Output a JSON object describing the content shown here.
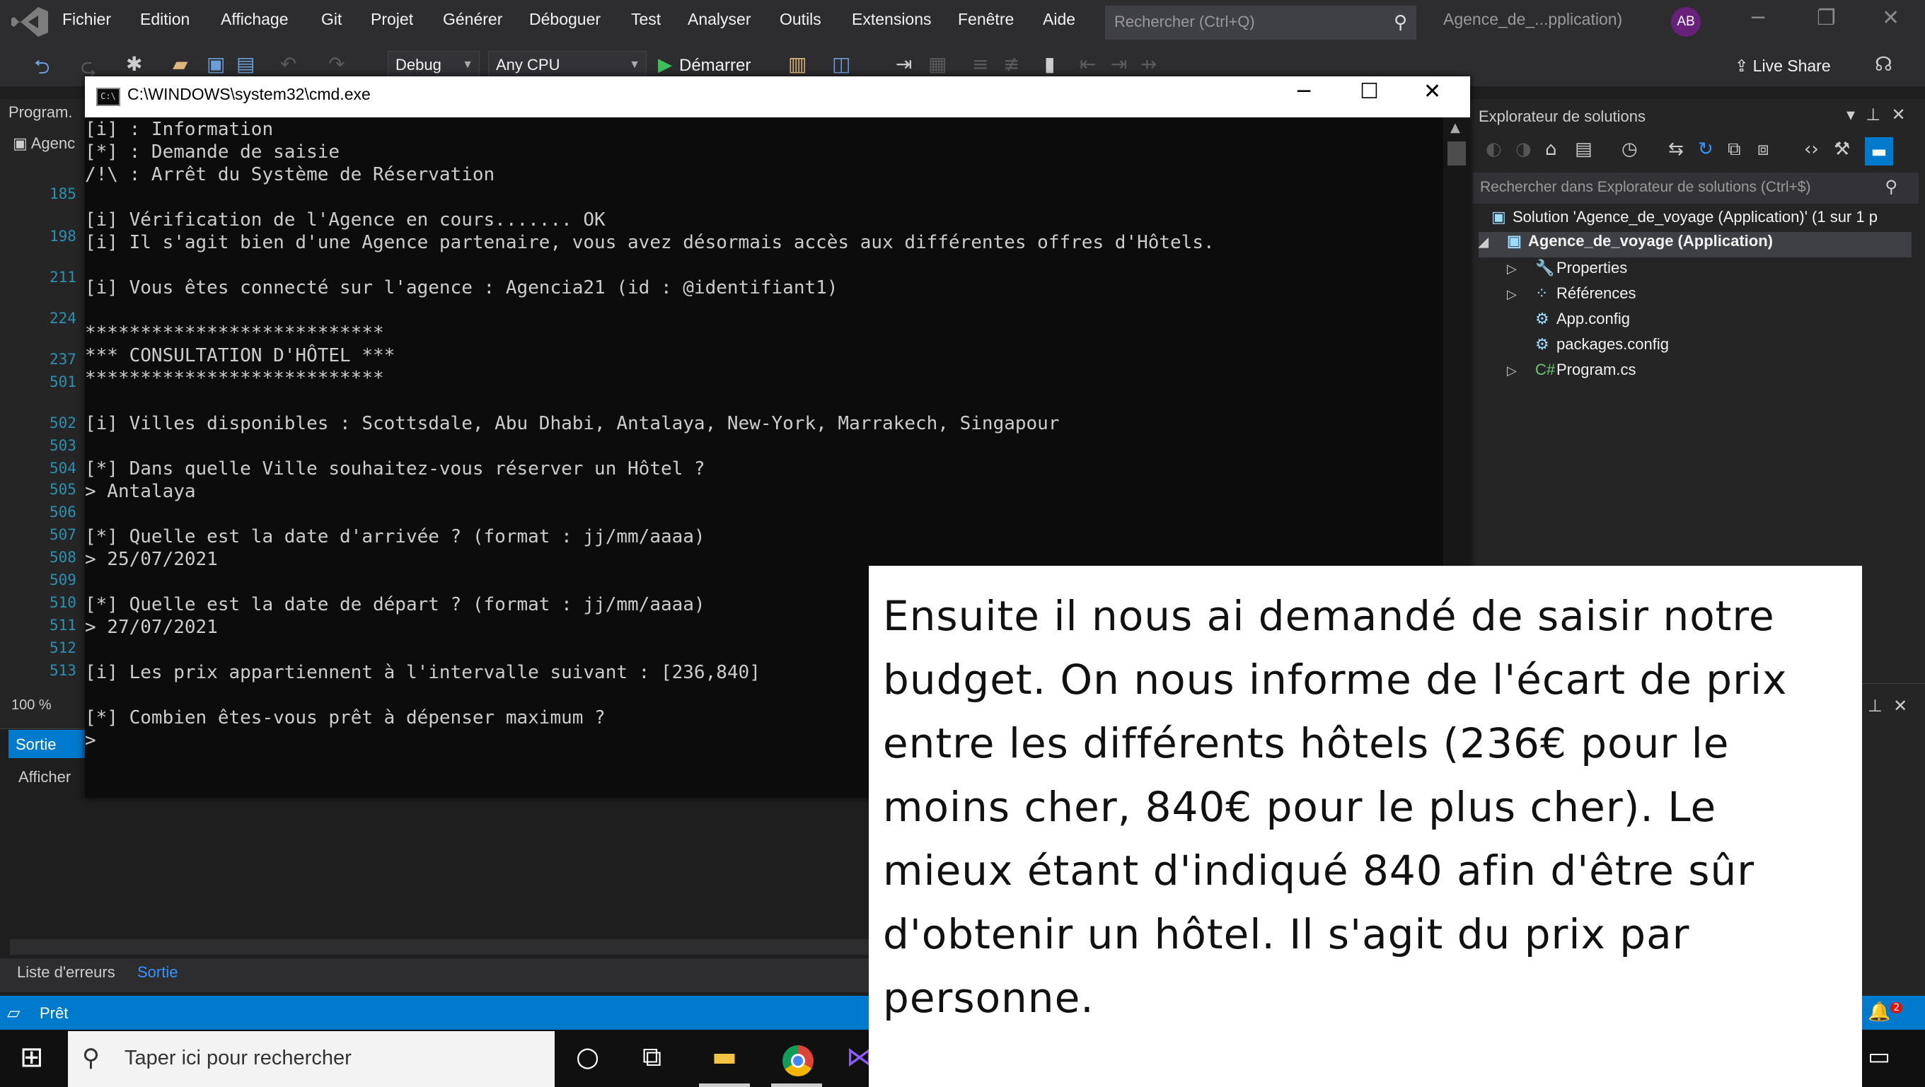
{
  "menubar": {
    "items": [
      "Fichier",
      "Edition",
      "Affichage",
      "Git",
      "Projet",
      "Générer",
      "Déboguer",
      "Test",
      "Analyser",
      "Outils",
      "Extensions",
      "Fenêtre",
      "Aide"
    ],
    "search_placeholder": "Rechercher (Ctrl+Q)",
    "project_name": "Agence_de_...pplication)",
    "user_initials": "AB"
  },
  "toolbar": {
    "config": "Debug",
    "platform": "Any CPU",
    "start_label": "Démarrer",
    "live_share": "Live Share"
  },
  "editor": {
    "tab_label": "Program.",
    "nav_label": "Agenc",
    "line_numbers": [
      "185",
      "198",
      "211",
      "224",
      "237",
      "501",
      "502",
      "503",
      "504",
      "505",
      "506",
      "507",
      "508",
      "509",
      "510",
      "511",
      "512",
      "513"
    ],
    "zoom": "100 %"
  },
  "output": {
    "tab_label": "Sortie",
    "show_label": "Afficher",
    "bottom_tabs": [
      "Liste d'erreurs",
      "Sortie"
    ]
  },
  "status": {
    "text": "Prêt",
    "notification_count": "2"
  },
  "solution_explorer": {
    "title": "Explorateur de solutions",
    "search_placeholder": "Rechercher dans Explorateur de solutions (Ctrl+$)",
    "solution_label": "Solution 'Agence_de_voyage (Application)' (1 sur 1 p",
    "project_label": "Agence_de_voyage (Application)",
    "items": [
      "Properties",
      "Références",
      "App.config",
      "packages.config",
      "Program.cs"
    ]
  },
  "cmd": {
    "title": "C:\\WINDOWS\\system32\\cmd.exe",
    "lines": [
      "[i] : Information",
      "[*] : Demande de saisie",
      "/!\\ : Arrêt du Système de Réservation",
      "",
      "[i] Vérification de l'Agence en cours....... OK",
      "[i] Il s'agit bien d'une Agence partenaire, vous avez désormais accès aux différentes offres d'Hôtels.",
      "",
      "[i] Vous êtes connecté sur l'agence : Agencia21 (id : @identifiant1)",
      "",
      "***************************",
      "*** CONSULTATION D'HÔTEL ***",
      "***************************",
      "",
      "[i] Villes disponibles : Scottsdale, Abu Dhabi, Antalaya, New-York, Marrakech, Singapour",
      "",
      "[*] Dans quelle Ville souhaitez-vous réserver un Hôtel ?",
      "> Antalaya",
      "",
      "[*] Quelle est la date d'arrivée ? (format : jj/mm/aaaa)",
      "> 25/07/2021",
      "",
      "[*] Quelle est la date de départ ? (format : jj/mm/aaaa)",
      "> 27/07/2021",
      "",
      "[i] Les prix appartiennent à l'intervalle suivant : [236,840]",
      "",
      "[*] Combien êtes-vous prêt à dépenser maximum ?",
      ">"
    ]
  },
  "taskbar": {
    "search_placeholder": "Taper ici pour rechercher"
  },
  "caption": {
    "text": "Ensuite il nous ai demandé de saisir notre budget. On nous informe de l'écart de prix entre les différents hôtels (236€ pour le moins cher, 840€ pour le plus cher). Le mieux étant d'indiqué 840 afin d'être sûr d'obtenir un hôtel. Il s'agit du prix par personne."
  }
}
